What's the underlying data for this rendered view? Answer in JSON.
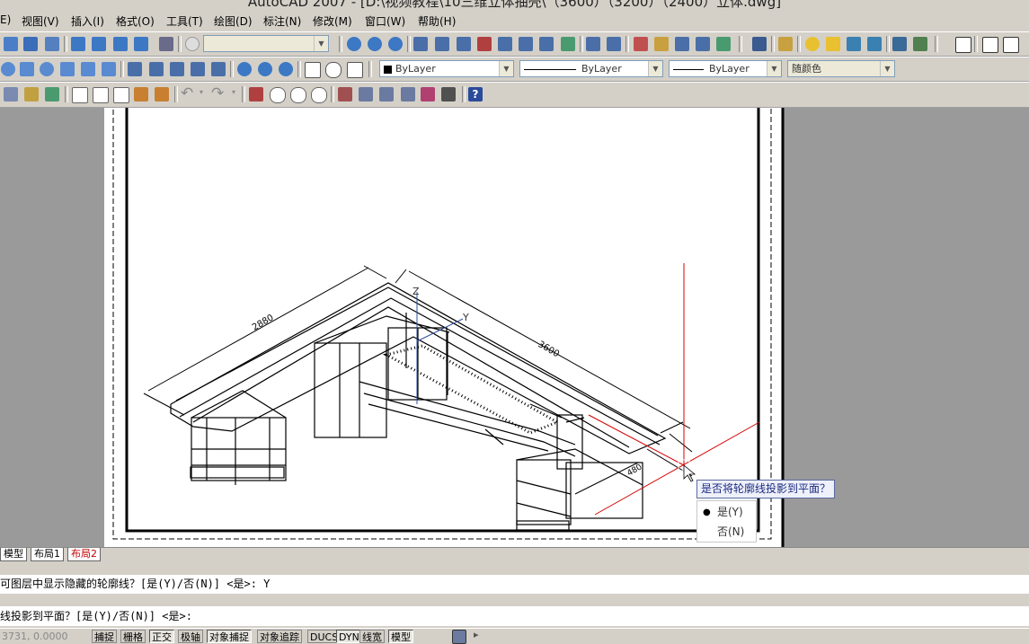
{
  "window": {
    "title": "AutoCAD 2007 - [D:\\视频教程\\10三维立体抽壳\\（3600）（3200）（2400）立体.dwg]"
  },
  "menu": [
    {
      "label": "E)"
    },
    {
      "label": "视图(V)"
    },
    {
      "label": "插入(I)"
    },
    {
      "label": "格式(O)"
    },
    {
      "label": "工具(T)"
    },
    {
      "label": "绘图(D)"
    },
    {
      "label": "标注(N)"
    },
    {
      "label": "修改(M)"
    },
    {
      "label": "窗口(W)"
    },
    {
      "label": "帮助(H)"
    }
  ],
  "properties": {
    "color": "ByLayer",
    "linetype": "ByLayer",
    "lineweight": "ByLayer",
    "plotstyle": "随颜色"
  },
  "drawing": {
    "dim_left": "2880",
    "dim_right": "3600",
    "dim_small": "480",
    "axis_z": "Z",
    "axis_y": "Y"
  },
  "tooltip": {
    "prompt": "是否将轮廓线投影到平面？",
    "option_yes": "是(Y)",
    "option_no": "否(N)"
  },
  "layout_tabs": {
    "model": "模型",
    "layout1": "布局1",
    "layout2": "布局2"
  },
  "command": {
    "line1": "可图层中显示隐藏的轮廓线？[是(Y)/否(N)] <是>: Y",
    "line2": "线投影到平面？[是(Y)/否(N)] <是>:"
  },
  "status": {
    "coords": "3731, 0.0000",
    "buttons": [
      "捕捉",
      "栅格",
      "正交",
      "极轴",
      "对象捕捉",
      "对象追踪",
      "DUCS",
      "DYN",
      "线宽",
      "模型"
    ]
  },
  "colors": {
    "crosshair": "#d40000",
    "tooltip_text": "#1a2a80"
  }
}
